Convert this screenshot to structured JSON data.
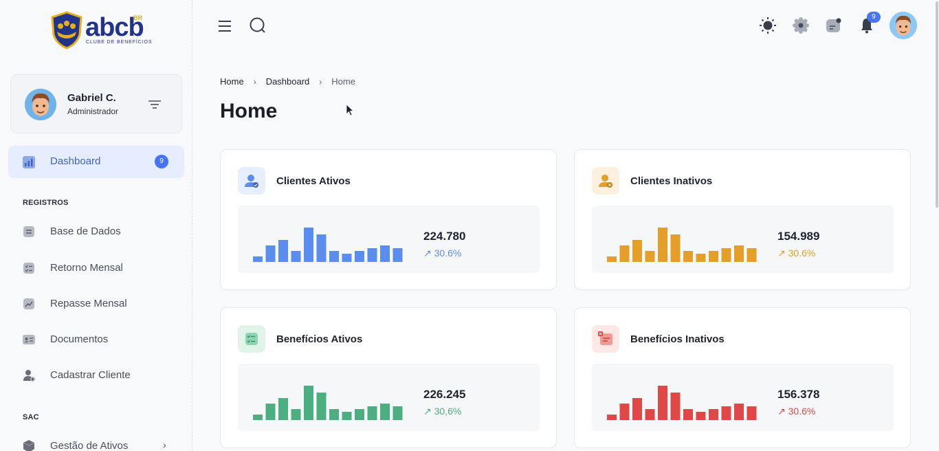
{
  "logo": {
    "brand": "abcb",
    "suffix": "BR",
    "tagline": "CLUBE DE BENEFÍCIOS"
  },
  "user": {
    "name": "Gabriel C.",
    "role": "Administrador"
  },
  "nav": {
    "active": {
      "label": "Dashboard",
      "badge": "9"
    },
    "sections": [
      {
        "title": "REGISTROS"
      },
      {
        "title": "SAC"
      }
    ],
    "items": [
      {
        "label": "Base de Dados",
        "icon": "database-icon"
      },
      {
        "label": "Retorno Mensal",
        "icon": "checklist-icon"
      },
      {
        "label": "Repasse Mensal",
        "icon": "trend-chart-icon"
      },
      {
        "label": "Documentos",
        "icon": "id-card-icon"
      },
      {
        "label": "Cadastrar Cliente",
        "icon": "add-user-icon"
      },
      {
        "label": "Gestão de Ativos",
        "icon": "box-icon"
      }
    ]
  },
  "topbar": {
    "notification_count": "9"
  },
  "breadcrumb": [
    "Home",
    "Dashboard",
    "Home"
  ],
  "page": {
    "title": "Home"
  },
  "cards": [
    {
      "title": "Clientes Ativos",
      "value": "224.780",
      "change": "30.6%",
      "color": "#5b8def",
      "icon": "user-check-icon",
      "icon_bg": "#e7eefd"
    },
    {
      "title": "Clientes Inativos",
      "value": "154.989",
      "change": "30.6%",
      "color": "#e39f27",
      "icon": "user-x-icon",
      "icon_bg": "#fdf0df"
    },
    {
      "title": "Benefícios Ativos",
      "value": "226.245",
      "change": "30,6%",
      "color": "#4caf82",
      "icon": "list-check-icon",
      "icon_bg": "#e1f4ea"
    },
    {
      "title": "Benefícios Inativos",
      "value": "156.378",
      "change": "30.6%",
      "color": "#e04848",
      "icon": "list-x-icon",
      "icon_bg": "#fde8e5"
    }
  ],
  "bar_levels": [
    0.16,
    0.48,
    0.64,
    0.32,
    1.0,
    0.8,
    0.32,
    0.24,
    0.32,
    0.4,
    0.48,
    0.4
  ]
}
